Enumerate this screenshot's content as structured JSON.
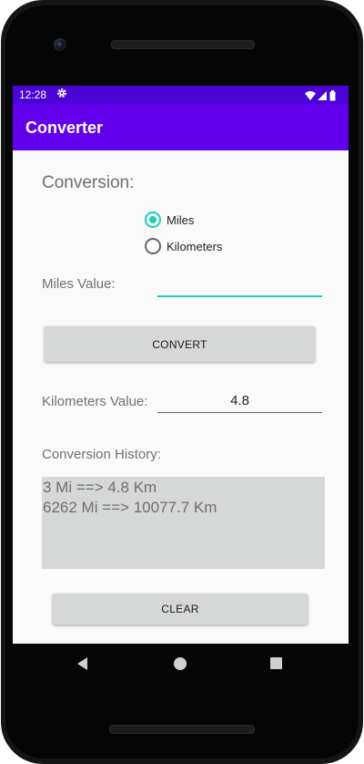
{
  "status_bar": {
    "time": "12:28",
    "icons": [
      "settings-icon",
      "wifi-icon",
      "signal-icon",
      "battery-icon"
    ]
  },
  "app_bar": {
    "title": "Converter"
  },
  "form": {
    "heading": "Conversion:",
    "unit_options": [
      {
        "label": "Miles",
        "checked": true
      },
      {
        "label": "Kilometers",
        "checked": false
      }
    ],
    "miles_label": "Miles Value:",
    "miles_input_value": "",
    "convert_label": "CONVERT",
    "km_label": "Kilometers Value:",
    "km_value": "4.8",
    "history_label": "Conversion History:",
    "history_lines": [
      "3 Mi ==> 4.8 Km",
      "6262 Mi ==> 10077.7 Km"
    ],
    "clear_label": "CLEAR"
  },
  "colors": {
    "status_bar": "#4b04d6",
    "app_bar": "#6200ee",
    "accent": "#1ecfb6",
    "button_bg": "#d6d7d7"
  },
  "nav_bar": {
    "icons": [
      "back-icon",
      "home-icon",
      "recent-apps-icon"
    ]
  }
}
